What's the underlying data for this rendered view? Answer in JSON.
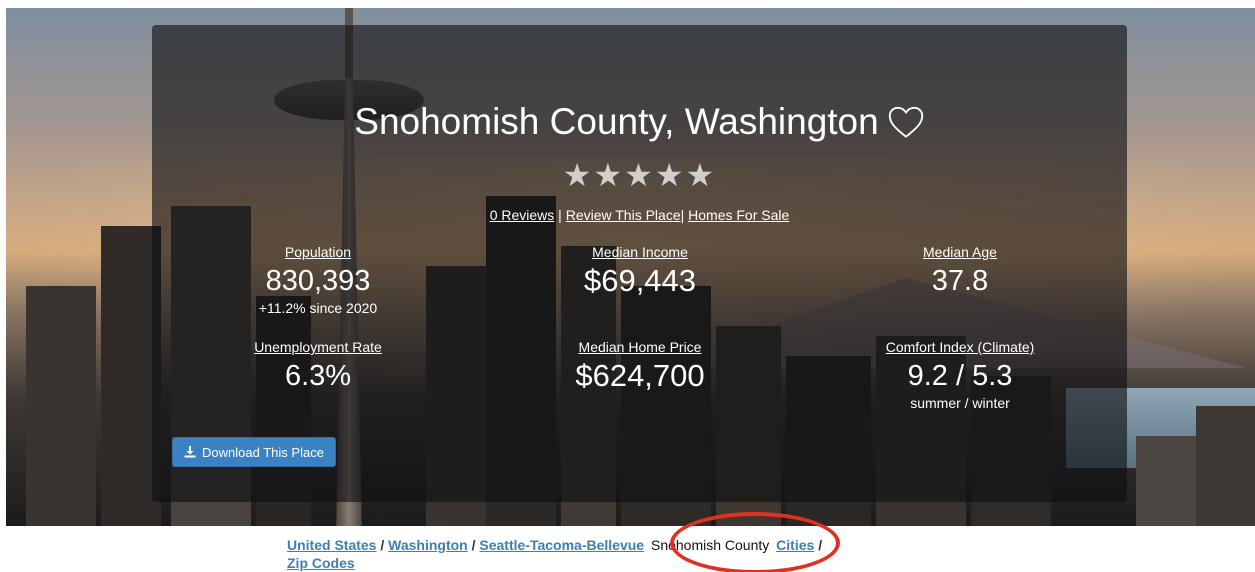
{
  "place": {
    "title": "Snohomish County, Washington",
    "stars": "★★★★★",
    "reviews_link": "0 Reviews",
    "separator": "|",
    "review_place_link": "Review This Place|",
    "homes_link": "Homes For Sale"
  },
  "stats": {
    "population": {
      "label": "Population",
      "value": "830,393",
      "note": "+11.2% since 2020"
    },
    "median_income": {
      "label": "Median Income",
      "value": "$69,443"
    },
    "median_age": {
      "label": "Median Age",
      "value": "37.8"
    },
    "unemployment": {
      "label": "Unemployment Rate",
      "value": "6.3%"
    },
    "median_home_price": {
      "label": "Median Home Price",
      "value": "$624,700"
    },
    "comfort": {
      "label": "Comfort Index (Climate)",
      "value": "9.2 / 5.3",
      "note": "summer / winter"
    }
  },
  "download_button": {
    "label": "Download This Place",
    "icon": "download-icon"
  },
  "breadcrumb": {
    "items": [
      "United States",
      "Washington",
      "Seattle-Tacoma-Bellevue",
      "Snohomish County",
      "Cities",
      "Zip Codes"
    ],
    "separator": "/"
  },
  "colors": {
    "link": "#3b7fb7",
    "button": "#3b82c4",
    "annotation_circle": "#e0311f"
  }
}
